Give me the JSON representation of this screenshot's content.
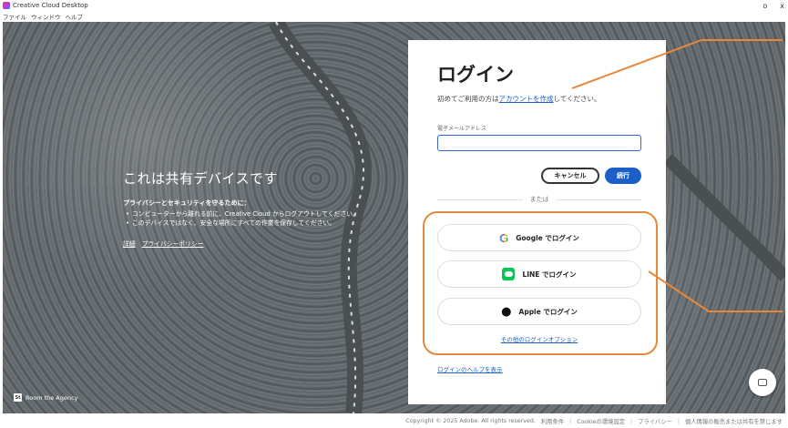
{
  "window": {
    "title": "Creative Cloud Desktop",
    "controls": [
      "o",
      "x"
    ]
  },
  "menu": [
    "ファイル",
    "ウィンドウ",
    "ヘルプ"
  ],
  "shared_device": {
    "title": "これは共有デバイスです",
    "subtitle": "プライバシーとセキュリティを守るために：",
    "items": [
      "コンピューターから離れる前に、Creative Cloud からログアウトしてください。",
      "このデバイスではなく、安全な場所にすべての作業を保存してください。"
    ],
    "links": [
      "詳細",
      "プライバシーポリシー"
    ]
  },
  "brand": {
    "logo": "St",
    "name": "Room the Agency"
  },
  "login": {
    "heading": "ログイン",
    "intro_prefix": "初めてご利用の方は",
    "intro_link": "アカウントを作成",
    "intro_suffix": "してください。",
    "email_label": "電子メールアドレス",
    "email_value": "",
    "cancel_label": "キャンセル",
    "continue_label": "続行",
    "divider_label": "または",
    "google_label": "Google でログイン",
    "line_label": "LINE でログイン",
    "apple_label": "Apple でログイン",
    "other_options": "その他のログインオプション",
    "help_link": "ログインのヘルプを表示"
  },
  "icons": {
    "google": "G",
    "apple": "",
    "line": "line-icon",
    "chat": "chat-icon"
  },
  "annotation_color": "#e8883a",
  "footer": {
    "copyright": "Copyright © 2025 Adobe. All rights reserved.",
    "links": [
      "利用条件",
      "Cookieの環境設定",
      "プライバシー",
      "個人情報の販売または共有を禁じます"
    ]
  }
}
